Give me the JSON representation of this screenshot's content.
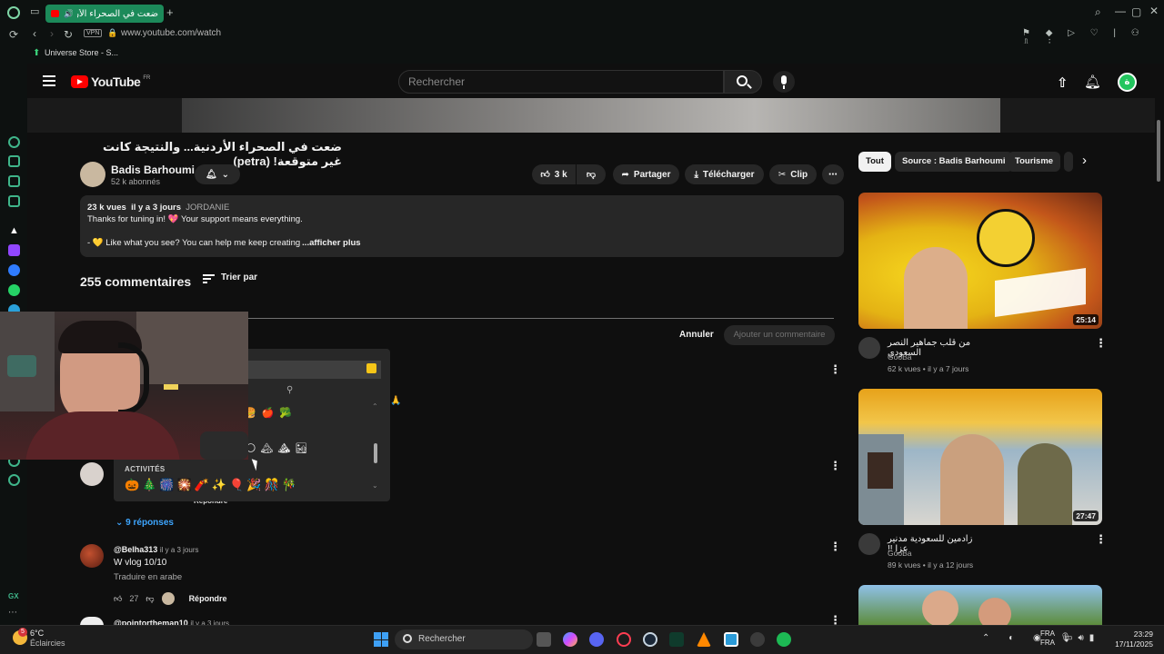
{
  "browser": {
    "tab_title": "ضعت في الصحراء الأردنية",
    "vpn_label": "VPN",
    "url": "www.youtube.com/watch",
    "bookmark": "Universe Store - S..."
  },
  "header": {
    "logo_text": "YouTube",
    "logo_region": "FR",
    "search_placeholder": "Rechercher",
    "profile_initial": "ة"
  },
  "video": {
    "title": "ضعت في الصحراء الأردنية... والنتيجة كانت غير متوقعة! (petra)",
    "channel": "Badis Barhoumi",
    "subscribers": "52 k abonnés",
    "likes": "3 k",
    "share_label": "Partager",
    "download_label": "Télécharger",
    "clip_label": "Clip",
    "description": {
      "views": "23 k vues",
      "age": "il y a 3 jours",
      "tag": "JORDANIE",
      "line1": "Thanks for tuning in! 💖 Your support means everything.",
      "line2": "- 💛 Like what you see? You can help me keep creating",
      "more": "...afficher plus"
    }
  },
  "comments": {
    "count": "255 commentaires",
    "sort_label": "Trier par",
    "cancel_label": "Annuler",
    "submit_label": "Ajouter un commentaire",
    "replies_label": "9 réponses",
    "reply_label": "Répondre",
    "items": [
      {
        "author": "@Belha313",
        "age": "il y a 3 jours",
        "text": "W vlog 10/10",
        "translate": "Traduire en arabe",
        "likes": "27",
        "reply": "Répondre"
      },
      {
        "author": "@pointortheman10",
        "age": "il y a 3 jours"
      }
    ]
  },
  "emoji_picker": {
    "category": "ACTIVITÉS",
    "row": "🎃🎄🎆🎇🧨✨🎈🎉🎊🎋"
  },
  "chips": [
    "Tout",
    "Source : Badis Barhoumi",
    "Tourisme"
  ],
  "related": [
    {
      "title": "من قلب جماهير النصر السعودي",
      "channel": "GooBa",
      "meta": "62 k vues • il y a 7 jours",
      "duration": "25:14"
    },
    {
      "title": "زادمين للسعودية مدنير عزا !!",
      "channel": "GooBa",
      "meta": "89 k vues • il y a 12 jours",
      "duration": "27:47"
    }
  ],
  "taskbar": {
    "temperature": "6°C",
    "weather": "Éclaircies",
    "search_placeholder": "Rechercher",
    "notif_count": "5",
    "lang_line1": "FRA",
    "lang_line2": "FRA",
    "time": "23:29",
    "date": "17/11/2025"
  }
}
